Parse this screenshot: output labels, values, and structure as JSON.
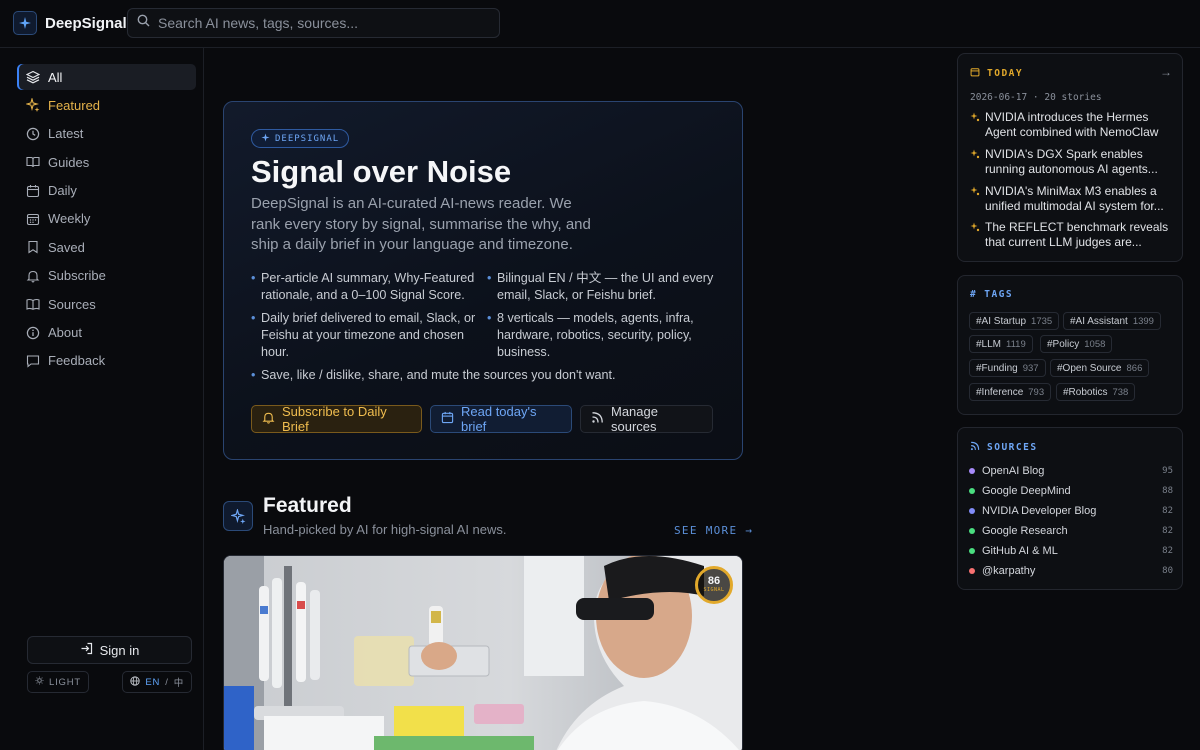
{
  "app": {
    "brand": "DeepSignal",
    "search_placeholder": "Search AI news, tags, sources..."
  },
  "sidebar": {
    "items": [
      {
        "label": "All",
        "icon": "layers-icon"
      },
      {
        "label": "Featured",
        "icon": "sparkle-icon"
      },
      {
        "label": "Latest",
        "icon": "clock-icon"
      },
      {
        "label": "Guides",
        "icon": "book-icon"
      },
      {
        "label": "Daily",
        "icon": "calendar-icon"
      },
      {
        "label": "Weekly",
        "icon": "calendar-week-icon"
      },
      {
        "label": "Saved",
        "icon": "bookmark-icon"
      },
      {
        "label": "Subscribe",
        "icon": "bell-icon"
      },
      {
        "label": "Sources",
        "icon": "book-open-icon"
      },
      {
        "label": "About",
        "icon": "info-icon"
      },
      {
        "label": "Feedback",
        "icon": "message-icon"
      }
    ],
    "active": "All",
    "sign_in": "Sign in",
    "theme_label": "LIGHT",
    "lang_en": "EN",
    "lang_sep": "/",
    "lang_zh": "中"
  },
  "hero": {
    "badge": "DEEPSIGNAL",
    "title": "Signal over Noise",
    "description": "DeepSignal is an AI-curated AI-news reader. We rank every story by signal, summarise the why, and ship a daily brief in your language and timezone.",
    "bullets": [
      "Per-article AI summary, Why-Featured rationale, and a 0–100 Signal Score.",
      "Bilingual EN / 中文 — the UI and every email, Slack, or Feishu brief.",
      "Daily brief delivered to email, Slack, or Feishu at your timezone and chosen hour.",
      "8 verticals — models, agents, infra, hardware, robotics, security, policy, business.",
      "Save, like / dislike, share, and mute the sources you don't want."
    ],
    "btn_subscribe": "Subscribe to Daily Brief",
    "btn_read": "Read today's brief",
    "btn_manage": "Manage sources"
  },
  "featured": {
    "title": "Featured",
    "subtitle": "Hand-picked by AI for high-signal AI news.",
    "see_more": "SEE MORE →",
    "signal_score": 86,
    "signal_label": "SIGNAL"
  },
  "today": {
    "title": "TODAY",
    "meta": "2026-06-17 · 20 stories",
    "stories": [
      "NVIDIA introduces the Hermes Agent combined with NemoClaw t...",
      "NVIDIA's DGX Spark enables running autonomous AI agents...",
      "NVIDIA's MiniMax M3 enables a unified multimodal AI system for...",
      "The REFLECT benchmark reveals that current LLM judges are..."
    ]
  },
  "tags": {
    "title": "TAGS",
    "items": [
      {
        "name": "#AI Startup",
        "count": "1735"
      },
      {
        "name": "#AI Assistant",
        "count": "1399"
      },
      {
        "name": "#LLM",
        "count": "1119"
      },
      {
        "name": "#Policy",
        "count": "1058"
      },
      {
        "name": "#Funding",
        "count": "937"
      },
      {
        "name": "#Open Source",
        "count": "866"
      },
      {
        "name": "#Inference",
        "count": "793"
      },
      {
        "name": "#Robotics",
        "count": "738"
      }
    ]
  },
  "sources": {
    "title": "SOURCES",
    "items": [
      {
        "name": "OpenAI Blog",
        "score": "95",
        "color": "#a78bfa"
      },
      {
        "name": "Google DeepMind",
        "score": "88",
        "color": "#4ade80"
      },
      {
        "name": "NVIDIA Developer Blog",
        "score": "82",
        "color": "#818cf8"
      },
      {
        "name": "Google Research",
        "score": "82",
        "color": "#4ade80"
      },
      {
        "name": "GitHub AI & ML",
        "score": "82",
        "color": "#4ade80"
      },
      {
        "name": "@karpathy",
        "score": "80",
        "color": "#f87171"
      }
    ]
  },
  "colors": {
    "accent_blue": "#3b82f6",
    "accent_gold": "#e2a92b",
    "background": "#090a0d"
  }
}
